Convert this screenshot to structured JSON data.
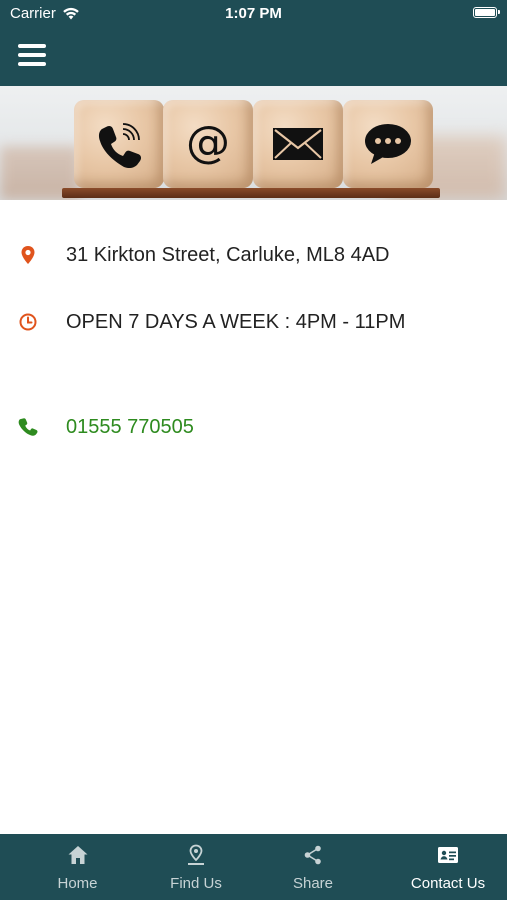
{
  "status_bar": {
    "carrier": "Carrier",
    "time": "1:07 PM"
  },
  "colors": {
    "primary": "#1f4d55",
    "icon_accent": "#e0541d",
    "phone_green": "#2e8b1f"
  },
  "hero": {
    "icons": [
      "phone-icon",
      "at-sign-icon",
      "envelope-icon",
      "chat-bubble-icon"
    ]
  },
  "contact": {
    "address": "31 Kirkton Street, Carluke, ML8 4AD",
    "hours": "OPEN 7 DAYS A WEEK : 4PM - 11PM",
    "phone": "01555 770505"
  },
  "tabs": [
    {
      "label": "Home",
      "icon": "home-icon",
      "active": false
    },
    {
      "label": "Find Us",
      "icon": "map-pin-icon",
      "active": false
    },
    {
      "label": "Share",
      "icon": "share-icon",
      "active": false
    },
    {
      "label": "Contact Us",
      "icon": "contact-card-icon",
      "active": true
    }
  ]
}
